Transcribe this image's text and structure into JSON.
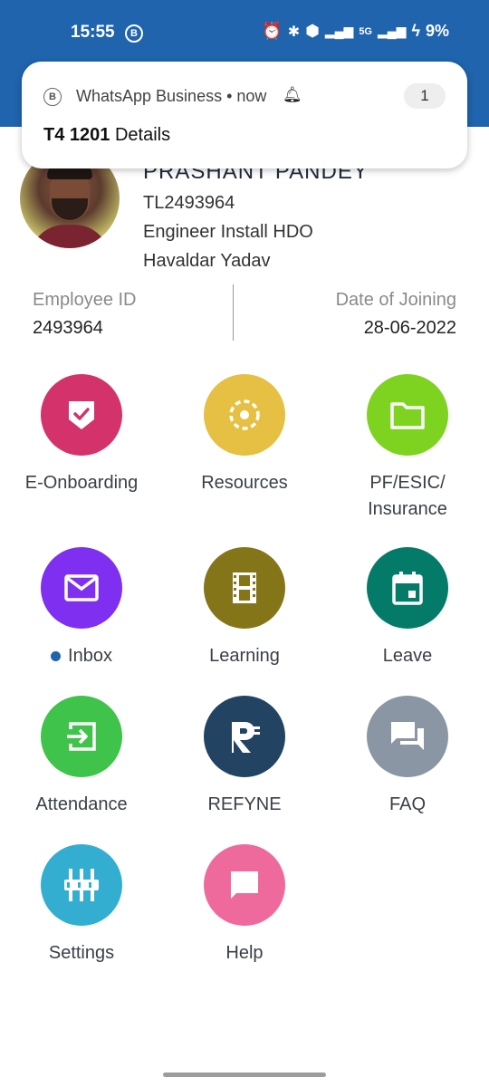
{
  "status_bar": {
    "time": "15:55",
    "b_badge": "B",
    "battery": "9%",
    "network": "5G"
  },
  "notification": {
    "app_icon": "B",
    "app_line": "WhatsApp Business • now",
    "count": "1",
    "title_bold": "T4 1201",
    "title_rest": " Details"
  },
  "profile": {
    "name": "PRASHANT PANDEY",
    "code": "TL2493964",
    "role": "Engineer Install HDO",
    "manager": "Havaldar Yadav"
  },
  "info": {
    "employee_id_label": "Employee ID",
    "employee_id": "2493964",
    "doj_label": "Date of Joining",
    "doj": "28-06-2022"
  },
  "tiles": [
    {
      "label": "E-Onboarding",
      "icon": "shield-check-icon",
      "color": "#d3336a"
    },
    {
      "label": "Resources",
      "icon": "dashed-circle-icon",
      "color": "#e6c043"
    },
    {
      "label": "PF/ESIC/\nInsurance",
      "label1": "PF/ESIC/",
      "label2": "Insurance",
      "icon": "folder-icon",
      "color": "#7ed321"
    },
    {
      "label": "Inbox",
      "icon": "mail-icon",
      "color": "#7e2ff0"
    },
    {
      "label": "Learning",
      "icon": "film-icon",
      "color": "#857519"
    },
    {
      "label": "Leave",
      "icon": "calendar-icon",
      "color": "#047a68"
    },
    {
      "label": "Attendance",
      "icon": "login-icon",
      "color": "#40c34a"
    },
    {
      "label": "REFYNE",
      "icon": "refyne-icon",
      "color": "#234363"
    },
    {
      "label": "FAQ",
      "icon": "chat-icon",
      "color": "#8a96a3"
    },
    {
      "label": "Settings",
      "icon": "sliders-icon",
      "color": "#33aed1"
    },
    {
      "label": "Help",
      "icon": "message-icon",
      "color": "#ef6a9c"
    }
  ]
}
